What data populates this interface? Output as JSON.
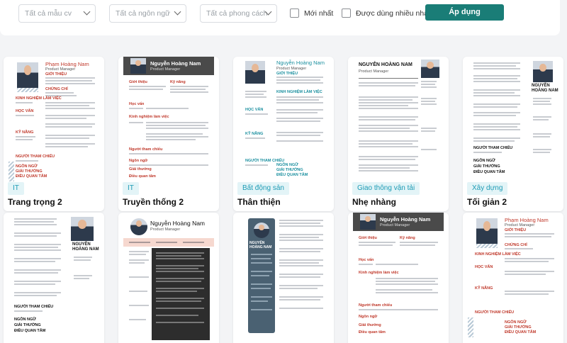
{
  "filters": {
    "sample": "Tất cả mẫu cv",
    "language": "Tất cả ngôn ngữ",
    "style": "Tất cả phong cách",
    "newest": "Mới nhất",
    "most_used": "Được dùng nhiều nhất",
    "apply": "Áp dụng"
  },
  "thumb_text": {
    "person_name": "Phạm Hoàng Nam",
    "person_name_alt": "Nguyễn Hoàng Nam",
    "person_name_upper": "NGUYỄN HOÀNG NAM",
    "person_name_stack1": "NGUYỄN",
    "person_name_stack2": "HOÀNG NAM",
    "role": "Product Manager",
    "h_intro": "GIỚI THIỆU",
    "h_intro_tc": "Giới thiệu",
    "h_skills": "Kỹ năng",
    "h_exp": "KINH NGHIỆM LÀM VIỆC",
    "h_exp_tc": "Kinh nghiệm làm việc",
    "h_edu": "HỌC VẤN",
    "h_edu_tc": "Học vấn",
    "h_skill_uc": "KỸ NĂNG",
    "h_cert": "CHỨNG CHỈ",
    "h_ref": "NGƯỜI THAM CHIẾU",
    "h_ref_tc": "Người tham chiếu",
    "h_lang": "NGÔN NGỮ",
    "h_lang_tc": "Ngôn ngữ",
    "h_award": "GIẢI THƯỞNG",
    "h_award_tc": "Giải thưởng",
    "h_hobby": "ĐIỀU QUAN TÂM",
    "h_hobby_tc": "Điều quan tâm"
  },
  "cards_row1": [
    {
      "tag": "IT",
      "name": "Trang trọng 2"
    },
    {
      "tag": "IT",
      "name": "Truyền thống 2"
    },
    {
      "tag": "Bất động sản",
      "name": "Thân thiện"
    },
    {
      "tag": "Giao thông vận tải",
      "name": "Nhẹ nhàng"
    },
    {
      "tag": "Xây dựng",
      "name": "Tối giản 2"
    }
  ],
  "colors": {
    "accent": "#1a7d77",
    "tag_bg": "#e3f4f7",
    "tag_text": "#1d9bb5",
    "red": "#c0392b",
    "teal": "#1a8f9f",
    "dark_header": "#4a4a4a",
    "slate": "#4a6172"
  }
}
